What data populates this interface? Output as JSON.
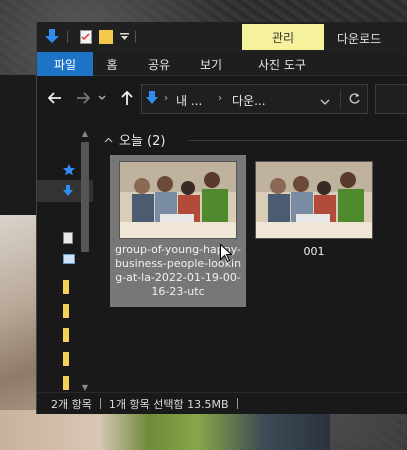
{
  "titlebar": {
    "context_tab": "관리",
    "right_label": "다운로드"
  },
  "ribbon": {
    "tabs": [
      {
        "label": "파일",
        "active": true
      },
      {
        "label": "홈"
      },
      {
        "label": "공유"
      },
      {
        "label": "보기"
      },
      {
        "label": "사진 도구"
      }
    ]
  },
  "address": {
    "crumbs": [
      "내 ...",
      "다운..."
    ]
  },
  "group": {
    "label": "오늘 (2)"
  },
  "files": [
    {
      "name": "group-of-young-happy-business-people-looking-at-la-2022-01-19-00-16-23-utc",
      "selected": true
    },
    {
      "name": "001",
      "selected": false
    }
  ],
  "status": {
    "item_count": "2개 항목",
    "selection": "1개 항목 선택함 13.5MB"
  },
  "colors": {
    "accent": "#1d73c5",
    "context_tab": "#f5f19c",
    "background": "#191919"
  }
}
